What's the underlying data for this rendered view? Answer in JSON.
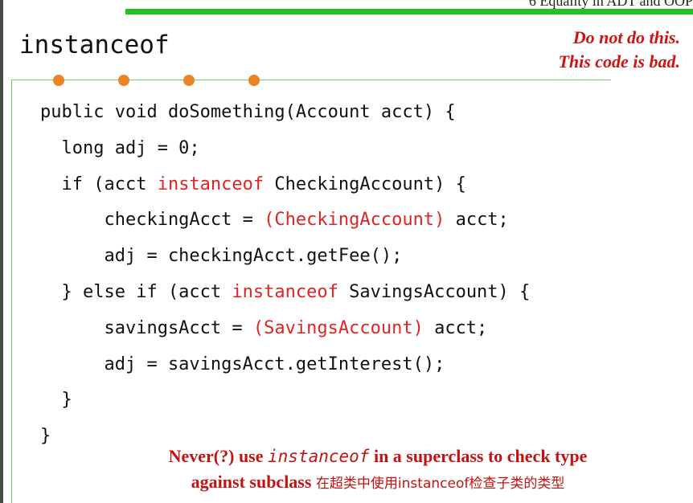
{
  "header": {
    "running_title": "6 Equality in ADT and OOP"
  },
  "slide": {
    "title": "instanceof",
    "warning_line1": "Do not do this.",
    "warning_line2": "This code is bad."
  },
  "code": {
    "lines": [
      [
        {
          "t": "public void doSomething(Account acct) {",
          "red": false
        }
      ],
      [
        {
          "t": "  long adj = 0;",
          "red": false
        }
      ],
      [
        {
          "t": "  if (acct ",
          "red": false
        },
        {
          "t": "instanceof",
          "red": true
        },
        {
          "t": " CheckingAccount) {",
          "red": false
        }
      ],
      [
        {
          "t": "      checkingAcct = ",
          "red": false
        },
        {
          "t": "(CheckingAccount)",
          "red": true
        },
        {
          "t": " acct;",
          "red": false
        }
      ],
      [
        {
          "t": "      adj = checkingAcct.getFee();",
          "red": false
        }
      ],
      [
        {
          "t": "  } else if (acct ",
          "red": false
        },
        {
          "t": "instanceof",
          "red": true
        },
        {
          "t": " SavingsAccount) {",
          "red": false
        }
      ],
      [
        {
          "t": "      savingsAcct = ",
          "red": false
        },
        {
          "t": "(SavingsAccount)",
          "red": true
        },
        {
          "t": " acct;",
          "red": false
        }
      ],
      [
        {
          "t": "      adj = savingsAcct.getInterest();",
          "red": false
        }
      ],
      [
        {
          "t": "  }",
          "red": false
        }
      ],
      [
        {
          "t": "}",
          "red": false
        }
      ]
    ]
  },
  "footer_note": {
    "part1": "Never(?) use ",
    "keyword": "instanceof",
    "part2": " in a superclass to check type",
    "line2": "against subclass ",
    "chinese": "在超类中使用instanceof检查子类的类型"
  },
  "colors": {
    "accent_green": "#1fc41f",
    "frame_green": "#6fc46f",
    "dot_orange": "#ee8325",
    "warning_red": "#d21212",
    "code_red": "#e02424"
  }
}
